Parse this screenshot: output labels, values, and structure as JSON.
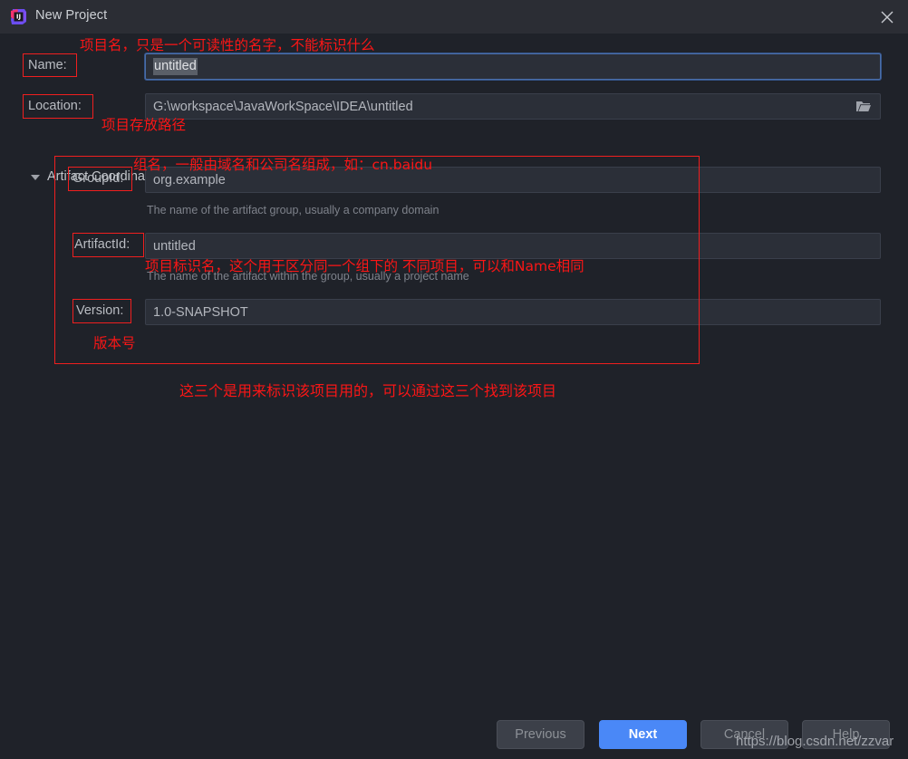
{
  "window": {
    "title": "New Project",
    "app_icon": "intellij-idea-icon",
    "close_icon": "close-icon"
  },
  "form": {
    "name": {
      "label": "Name:",
      "value": "untitled",
      "selected": true
    },
    "location": {
      "label": "Location:",
      "value": "G:\\workspace\\JavaWorkSpace\\IDEA\\untitled",
      "browse_icon": "folder-icon"
    },
    "group_section": {
      "title": "Artifact Coordinates",
      "expanded": true,
      "arrow_icon": "chevron-down-icon"
    },
    "group_id": {
      "label": "GroupId:",
      "value": "org.example",
      "hint": "The name of the artifact group, usually a company domain"
    },
    "artifact_id": {
      "label": "ArtifactId:",
      "value": "untitled",
      "hint": "The name of the artifact within the group, usually a project name"
    },
    "version": {
      "label": "Version:",
      "value": "1.0-SNAPSHOT"
    }
  },
  "annotations": {
    "color": "#fb1616",
    "name_note": "项目名，只是一个可读性的名字，不能标识什么",
    "location_note": "项目存放路径",
    "group_id_note": "组名，一般由域名和公司名组成，如：cn.baidu",
    "artifact_id_note": "项目标识名，这个用于区分同一个组下的 不同项目，可以和Name相同",
    "version_note": "版本号",
    "summary_note": "这三个是用来标识该项目用的，可以通过这三个找到该项目"
  },
  "footer": {
    "previous": "Previous",
    "next": "Next",
    "cancel": "Cancel",
    "help": "Help"
  },
  "watermark": "https://blog.csdn.net/zzvar"
}
